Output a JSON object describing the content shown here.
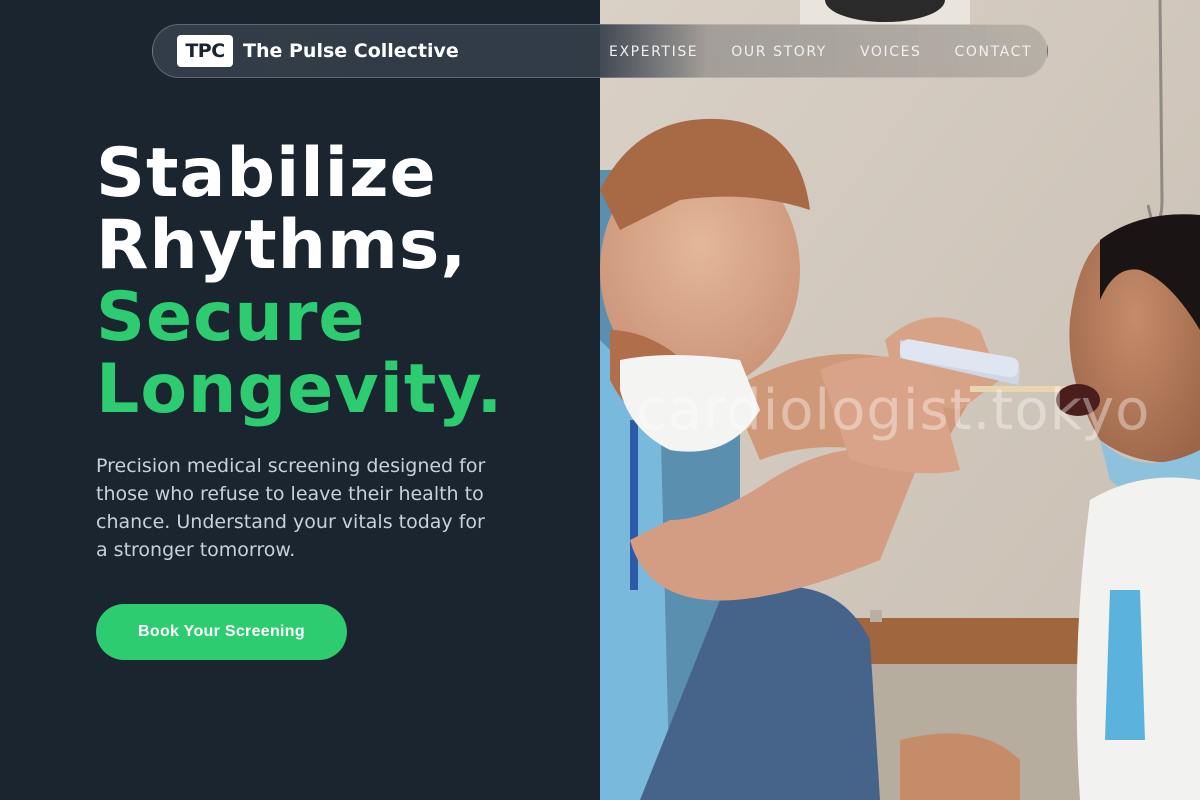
{
  "brand": {
    "badge": "TPC",
    "name": "The Pulse Collective"
  },
  "nav": {
    "links": [
      "EXPERTISE",
      "OUR STORY",
      "VOICES",
      "CONTACT"
    ]
  },
  "hero": {
    "title_lines": [
      "Stabilize",
      "Rhythms,",
      "Secure",
      "Longevity."
    ],
    "description": "Precision medical screening designed for those who refuse to leave their health to chance. Understand your vitals today for a stronger tomorrow.",
    "cta_label": "Book Your Screening"
  },
  "image": {
    "watermark": "cardiologist.tokyo"
  },
  "colors": {
    "background": "#1b2530",
    "accent": "#2ecc71",
    "text_light": "#ffffff",
    "text_muted": "#c9d0d8"
  }
}
